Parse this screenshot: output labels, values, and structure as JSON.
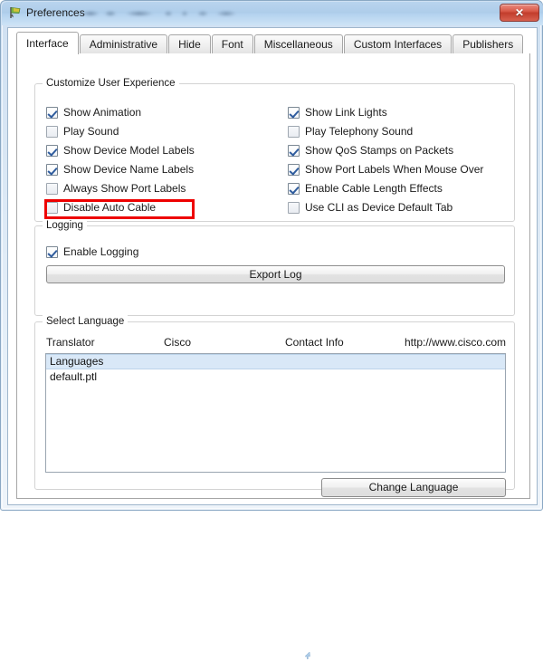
{
  "window": {
    "title": "Preferences",
    "icon": "flag-icon",
    "close_label": "✕",
    "blurred_title_suffix": ""
  },
  "tabs": [
    {
      "label": "Interface",
      "active": true
    },
    {
      "label": "Administrative",
      "active": false
    },
    {
      "label": "Hide",
      "active": false
    },
    {
      "label": "Font",
      "active": false
    },
    {
      "label": "Miscellaneous",
      "active": false
    },
    {
      "label": "Custom Interfaces",
      "active": false
    },
    {
      "label": "Publishers",
      "active": false
    }
  ],
  "customize_group": {
    "title": "Customize User Experience",
    "left_column": [
      {
        "label": "Show Animation",
        "checked": true
      },
      {
        "label": "Play Sound",
        "checked": false
      },
      {
        "label": "Show Device Model Labels",
        "checked": true
      },
      {
        "label": "Show Device Name Labels",
        "checked": true
      },
      {
        "label": "Always Show Port Labels",
        "checked": false,
        "highlighted": true
      },
      {
        "label": "Disable Auto Cable",
        "checked": false
      }
    ],
    "right_column": [
      {
        "label": "Show Link Lights",
        "checked": true
      },
      {
        "label": "Play Telephony Sound",
        "checked": false
      },
      {
        "label": "Show QoS Stamps on Packets",
        "checked": true
      },
      {
        "label": "Show Port Labels When Mouse Over",
        "checked": true
      },
      {
        "label": "Enable Cable Length Effects",
        "checked": true
      },
      {
        "label": "Use CLI as Device Default Tab",
        "checked": false
      }
    ]
  },
  "logging_group": {
    "title": "Logging",
    "enable_logging": {
      "label": "Enable Logging",
      "checked": true
    },
    "export_button": "Export Log"
  },
  "language_group": {
    "title": "Select Language",
    "columns": [
      "Translator",
      "Cisco",
      "Contact Info",
      "http://www.cisco.com"
    ],
    "items": [
      {
        "label": "Languages",
        "selected": true
      },
      {
        "label": "default.ptl",
        "selected": false
      }
    ],
    "change_button": "Change Language"
  },
  "colors": {
    "highlight_red": "#ee0000",
    "selection_blue": "#d9e8f7",
    "titlebar_blue": "#aecdea",
    "close_red": "#c23d2c",
    "check_blue": "#2f5c9e"
  }
}
